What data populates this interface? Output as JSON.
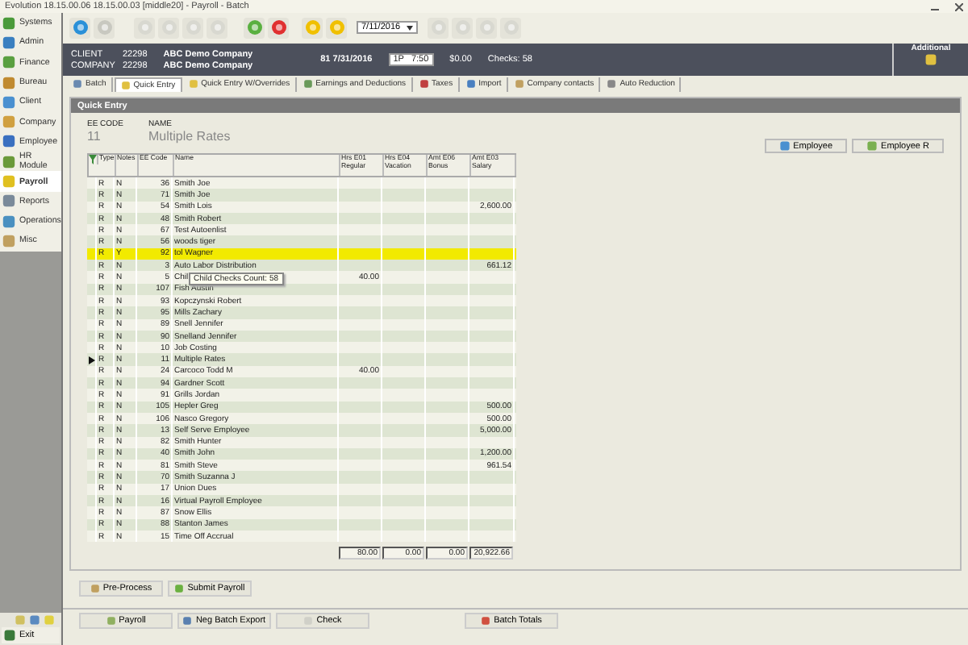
{
  "window": {
    "title": "Evolution 18.15.00.06  18.15.00.03 [middle20] - Payroll - Batch"
  },
  "sidebar": {
    "items": [
      {
        "label": "Systems",
        "selected": false
      },
      {
        "label": "Admin",
        "selected": false
      },
      {
        "label": "Finance",
        "selected": false
      },
      {
        "label": "Bureau",
        "selected": false
      },
      {
        "label": "Client",
        "selected": false
      },
      {
        "label": "Company",
        "selected": false
      },
      {
        "label": "Employee",
        "selected": false
      },
      {
        "label": "HR Module",
        "selected": false
      },
      {
        "label": "Payroll",
        "selected": true
      },
      {
        "label": "Reports",
        "selected": false
      },
      {
        "label": "Operations",
        "selected": false
      },
      {
        "label": "Misc",
        "selected": false
      }
    ],
    "exit": "Exit"
  },
  "toolbar": {
    "date": "7/11/2016"
  },
  "header": {
    "client_label": "CLIENT",
    "client_code": "22298",
    "client_name": "ABC Demo Company",
    "company_label": "COMPANY",
    "company_code": "22298",
    "company_name": "ABC Demo Company",
    "batch": "81 7/31/2016",
    "period": "1P   7:50",
    "amount": "$0.00",
    "checks": "Checks: 58",
    "additional": "Additional"
  },
  "tabs": [
    {
      "label": "Batch",
      "selected": false
    },
    {
      "label": "Quick Entry",
      "selected": true
    },
    {
      "label": "Quick Entry W/Overrides",
      "selected": false
    },
    {
      "label": "Earnings and Deductions",
      "selected": false
    },
    {
      "label": "Taxes",
      "selected": false
    },
    {
      "label": "Import",
      "selected": false
    },
    {
      "label": "Company contacts",
      "selected": false
    },
    {
      "label": "Auto Reduction",
      "selected": false
    }
  ],
  "panel": {
    "title": "Quick Entry",
    "ee_code_label": "EE CODE",
    "name_label": "NAME",
    "ee_code": "11",
    "name": "Multiple Rates",
    "buttons": [
      "Employee",
      "Employee R"
    ]
  },
  "grid": {
    "columns": [
      "Type",
      "Notes",
      "EE Code",
      "Name",
      "Hrs E01 Regular",
      "Hrs E04 Vacation",
      "Amt E06 Bonus",
      "Amt E03 Salary"
    ],
    "rows": [
      {
        "type": "R",
        "notes": "N",
        "ee_code": "36",
        "name": "Smith Joe",
        "selected": false,
        "current": false
      },
      {
        "type": "R",
        "notes": "N",
        "ee_code": "71",
        "name": "Smith Joe",
        "selected": false,
        "current": false
      },
      {
        "type": "R",
        "notes": "N",
        "ee_code": "54",
        "name": "Smith Lois",
        "salary": "2,600.00",
        "selected": false,
        "current": false
      },
      {
        "type": "R",
        "notes": "N",
        "ee_code": "48",
        "name": "Smith Robert",
        "selected": false,
        "current": false
      },
      {
        "type": "R",
        "notes": "N",
        "ee_code": "67",
        "name": "Test Autoenlist",
        "selected": false,
        "current": false
      },
      {
        "type": "R",
        "notes": "N",
        "ee_code": "56",
        "name": "woods tiger",
        "selected": false,
        "current": false
      },
      {
        "type": "R",
        "notes": "Y",
        "ee_code": "92",
        "name": "tol Wagner",
        "selected": true,
        "current": false
      },
      {
        "type": "R",
        "notes": "N",
        "ee_code": "3",
        "name": "Auto Labor Distribution",
        "salary": "661.12",
        "selected": false,
        "current": false
      },
      {
        "type": "R",
        "notes": "N",
        "ee_code": "5",
        "name": "Chil",
        "regular": "40.00",
        "tooltip": "Child Checks Count: 58",
        "selected": false,
        "current": false
      },
      {
        "type": "R",
        "notes": "N",
        "ee_code": "107",
        "name": "Fish Austin",
        "selected": false,
        "current": false
      },
      {
        "type": "R",
        "notes": "N",
        "ee_code": "93",
        "name": "Kopczynski Robert",
        "selected": false,
        "current": false
      },
      {
        "type": "R",
        "notes": "N",
        "ee_code": "95",
        "name": "Mills Zachary",
        "selected": false,
        "current": false
      },
      {
        "type": "R",
        "notes": "N",
        "ee_code": "89",
        "name": "Snell Jennifer",
        "selected": false,
        "current": false
      },
      {
        "type": "R",
        "notes": "N",
        "ee_code": "90",
        "name": "Snelland Jennifer",
        "selected": false,
        "current": false
      },
      {
        "type": "R",
        "notes": "N",
        "ee_code": "10",
        "name": "Job Costing",
        "selected": false,
        "current": false
      },
      {
        "type": "R",
        "notes": "N",
        "ee_code": "11",
        "name": "Multiple Rates",
        "selected": false,
        "current": true
      },
      {
        "type": "R",
        "notes": "N",
        "ee_code": "24",
        "name": "Carcoco Todd M",
        "regular": "40.00",
        "selected": false,
        "current": false
      },
      {
        "type": "R",
        "notes": "N",
        "ee_code": "94",
        "name": "Gardner Scott",
        "selected": false,
        "current": false
      },
      {
        "type": "R",
        "notes": "N",
        "ee_code": "91",
        "name": "Grills Jordan",
        "selected": false,
        "current": false
      },
      {
        "type": "R",
        "notes": "N",
        "ee_code": "105",
        "name": "Hepler Greg",
        "salary": "500.00",
        "selected": false,
        "current": false
      },
      {
        "type": "R",
        "notes": "N",
        "ee_code": "106",
        "name": "Nasco Gregory",
        "salary": "500.00",
        "selected": false,
        "current": false
      },
      {
        "type": "R",
        "notes": "N",
        "ee_code": "13",
        "name": "Self Serve Employee",
        "salary": "5,000.00",
        "selected": false,
        "current": false
      },
      {
        "type": "R",
        "notes": "N",
        "ee_code": "82",
        "name": "Smith Hunter",
        "selected": false,
        "current": false
      },
      {
        "type": "R",
        "notes": "N",
        "ee_code": "40",
        "name": "Smith John",
        "salary": "1,200.00",
        "selected": false,
        "current": false
      },
      {
        "type": "R",
        "notes": "N",
        "ee_code": "81",
        "name": "Smith Steve",
        "salary": "961.54",
        "selected": false,
        "current": false
      },
      {
        "type": "R",
        "notes": "N",
        "ee_code": "70",
        "name": "Smith Suzanna J",
        "selected": false,
        "current": false
      },
      {
        "type": "R",
        "notes": "N",
        "ee_code": "17",
        "name": "Union Dues",
        "selected": false,
        "current": false
      },
      {
        "type": "R",
        "notes": "N",
        "ee_code": "16",
        "name": "Virtual Payroll Employee",
        "selected": false,
        "current": false
      },
      {
        "type": "R",
        "notes": "N",
        "ee_code": "87",
        "name": "Snow Ellis",
        "selected": false,
        "current": false
      },
      {
        "type": "R",
        "notes": "N",
        "ee_code": "88",
        "name": "Stanton James",
        "selected": false,
        "current": false
      },
      {
        "type": "R",
        "notes": "N",
        "ee_code": "15",
        "name": "Time Off Accrual",
        "selected": false,
        "current": false
      }
    ],
    "totals": [
      "80.00",
      "0.00",
      "0.00",
      "20,922.66"
    ]
  },
  "actions": [
    "Pre-Process",
    "Submit Payroll"
  ],
  "bottom_buttons": [
    "Payroll",
    "Neg Batch Export",
    "Check",
    "Batch Totals"
  ]
}
